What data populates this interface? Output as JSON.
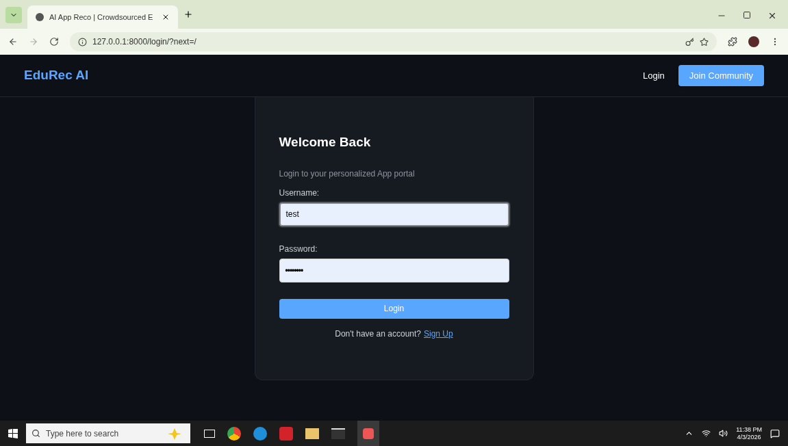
{
  "browser": {
    "tab_title": "AI App Reco | Crowdsourced E",
    "url": "127.0.0.1:8000/login/?next=/"
  },
  "navbar": {
    "brand": "EduRec AI",
    "links": [
      {
        "label": "Login",
        "kind": "link"
      },
      {
        "label": "Join Community",
        "kind": "button"
      }
    ]
  },
  "login_card": {
    "title": "Welcome Back",
    "subtitle": "Login to your personalized App portal",
    "fields": [
      {
        "label": "Username:",
        "value": "test",
        "focused": true,
        "kind": "text"
      },
      {
        "label": "Password:",
        "value": "••••••••",
        "focused": false,
        "kind": "password"
      }
    ],
    "submit": "Login",
    "footer_text": "Don't have an account?",
    "footer_link": "Sign Up"
  },
  "taskbar": {
    "search_placeholder": "Type here to search",
    "time": "11:38 PM",
    "date": "4/3/2026"
  }
}
